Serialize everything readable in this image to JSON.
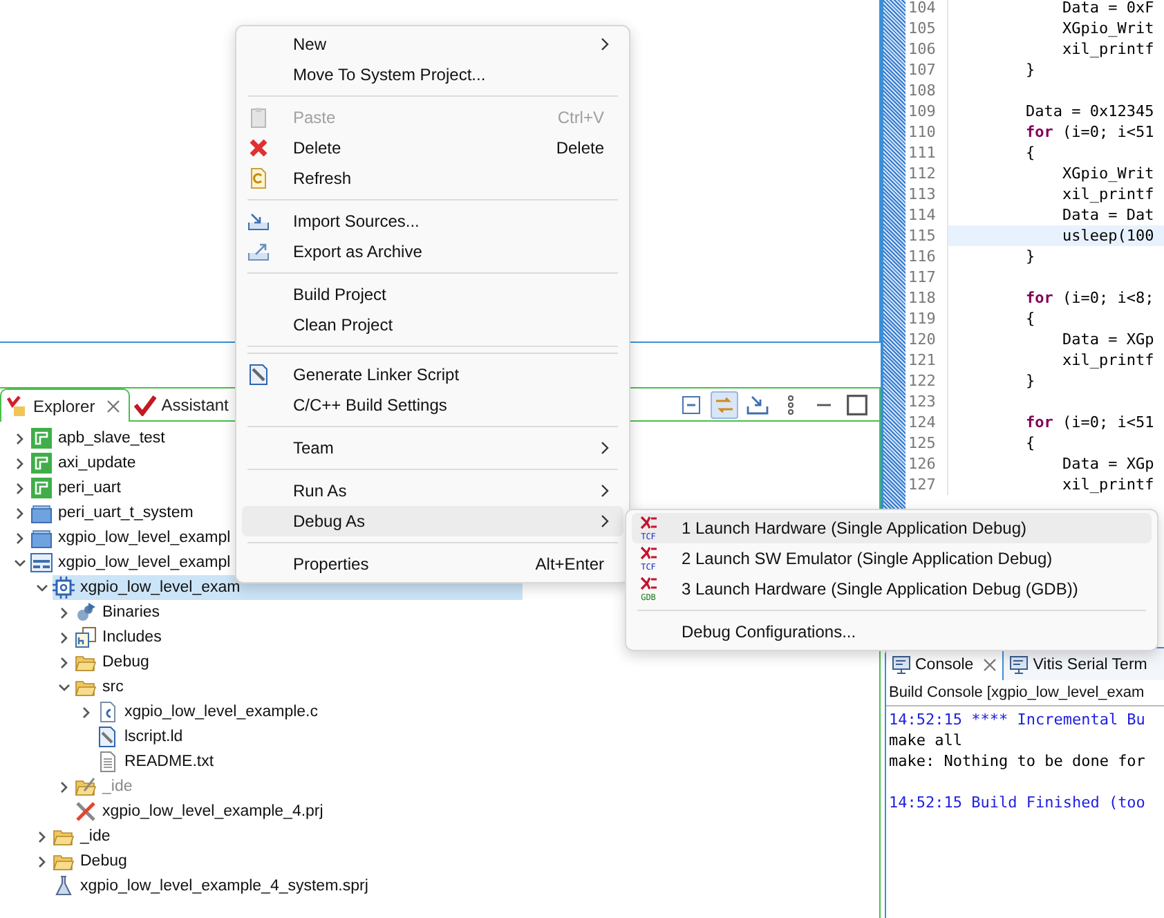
{
  "explorer": {
    "tabs": [
      {
        "label": "Explorer",
        "closable": true,
        "selected": true
      },
      {
        "label": "Assistant",
        "closable": false,
        "selected": false
      }
    ],
    "toolbar": [
      {
        "selected": false
      },
      {
        "selected": true
      },
      {
        "selected": false
      },
      {
        "selected": false
      },
      {
        "selected": false
      },
      {
        "selected": false
      }
    ],
    "tree": [
      {
        "label": "apb_slave_test",
        "kind": "app",
        "expanded": false,
        "selected": false,
        "greyed": false
      },
      {
        "label": "axi_update",
        "kind": "app",
        "expanded": false,
        "selected": false,
        "greyed": false
      },
      {
        "label": "peri_uart",
        "kind": "app",
        "expanded": false,
        "selected": false,
        "greyed": false
      },
      {
        "label": "peri_uart_t_system",
        "kind": "system",
        "expanded": false,
        "selected": false,
        "greyed": false
      },
      {
        "label": "xgpio_low_level_exampl",
        "kind": "system",
        "expanded": false,
        "selected": false,
        "greyed": false
      },
      {
        "label": "xgpio_low_level_exampl",
        "kind": "project",
        "expanded": true,
        "selected": false,
        "greyed": false,
        "children": [
          {
            "label": "xgpio_low_level_exam",
            "kind": "chip",
            "expanded": true,
            "selected": true,
            "greyed": false,
            "children": [
              {
                "label": "Binaries",
                "kind": "binaries",
                "expanded": false,
                "selected": false,
                "greyed": false
              },
              {
                "label": "Includes",
                "kind": "includes",
                "expanded": false,
                "selected": false,
                "greyed": false
              },
              {
                "label": "Debug",
                "kind": "folder",
                "expanded": false,
                "selected": false,
                "greyed": false
              },
              {
                "label": "src",
                "kind": "folder",
                "expanded": true,
                "selected": false,
                "greyed": false,
                "children": [
                  {
                    "label": "xgpio_low_level_example.c",
                    "kind": "cfile",
                    "expanded": false,
                    "selected": false,
                    "greyed": false
                  },
                  {
                    "label": "lscript.ld",
                    "kind": "ldfile",
                    "selected": false,
                    "greyed": false
                  },
                  {
                    "label": "README.txt",
                    "kind": "textfile",
                    "selected": false,
                    "greyed": false
                  }
                ]
              },
              {
                "label": "_ide",
                "kind": "idefolder",
                "expanded": false,
                "selected": false,
                "greyed": true
              },
              {
                "label": "xgpio_low_level_example_4.prj",
                "kind": "prj",
                "selected": false,
                "greyed": false
              }
            ]
          },
          {
            "label": "_ide",
            "kind": "folder",
            "expanded": false,
            "selected": false,
            "greyed": false
          },
          {
            "label": "Debug",
            "kind": "folder",
            "expanded": false,
            "selected": false,
            "greyed": false
          },
          {
            "label": "xgpio_low_level_example_4_system.sprj",
            "kind": "sprj",
            "selected": false,
            "greyed": false
          }
        ]
      }
    ]
  },
  "editor": {
    "lines": [
      {
        "number": "104",
        "text": "            Data = 0xF",
        "current": false
      },
      {
        "number": "105",
        "text": "            XGpio_Writ",
        "current": false
      },
      {
        "number": "106",
        "text": "            xil_printf",
        "current": false
      },
      {
        "number": "107",
        "text": "        }",
        "current": false
      },
      {
        "number": "108",
        "current": false
      },
      {
        "number": "109",
        "text": "        Data = 0x12345",
        "current": false
      },
      {
        "number": "110",
        "text": "        **for** (i=0; i<51",
        "current": false
      },
      {
        "number": "111",
        "text": "        {",
        "current": false
      },
      {
        "number": "112",
        "text": "            XGpio_Writ",
        "current": false
      },
      {
        "number": "113",
        "text": "            xil_printf",
        "current": false
      },
      {
        "number": "114",
        "text": "            Data = Dat",
        "current": false
      },
      {
        "number": "115",
        "text": "            usleep(100",
        "current": true
      },
      {
        "number": "116",
        "text": "        }",
        "current": false
      },
      {
        "number": "117",
        "current": false
      },
      {
        "number": "118",
        "text": "        **for** (i=0; i<8;",
        "current": false
      },
      {
        "number": "119",
        "text": "        {",
        "current": false
      },
      {
        "number": "120",
        "text": "            Data = XGp",
        "current": false
      },
      {
        "number": "121",
        "text": "            xil_printf",
        "current": false
      },
      {
        "number": "122",
        "text": "        }",
        "current": false
      },
      {
        "number": "123",
        "current": false
      },
      {
        "number": "124",
        "text": "        **for** (i=0; i<51",
        "current": false
      },
      {
        "number": "125",
        "text": "        {",
        "current": false
      },
      {
        "number": "126",
        "text": "            Data = XGp",
        "current": false
      },
      {
        "number": "127",
        "text": "            xil_printf",
        "current": false
      }
    ]
  },
  "console": {
    "tabs": [
      {
        "label": "Console",
        "closable": true,
        "selected": true
      },
      {
        "label": "Vitis Serial Term",
        "closable": false,
        "selected": false
      }
    ],
    "header": "Build Console [xgpio_low_level_exam",
    "lines": [
      {
        "kind": "output",
        "text": "14:52:15 **** Incremental Bu",
        "color": "#2020e0"
      },
      {
        "kind": "output",
        "text": "make all",
        "color": "#000000"
      },
      {
        "kind": "output",
        "text": "make: Nothing to be done for",
        "color": "#000000"
      },
      {
        "kind": "blank"
      },
      {
        "kind": "output",
        "text": "14:52:15 Build Finished (too",
        "color": "#2020e0"
      }
    ]
  },
  "context_menu": {
    "items": [
      {
        "kind": "item",
        "label": "New",
        "submenu": true,
        "disabled": false,
        "selected": false
      },
      {
        "kind": "item",
        "label": "Move To System Project...",
        "submenu": false,
        "disabled": false,
        "selected": false
      },
      {
        "kind": "separator"
      },
      {
        "kind": "item",
        "label": "Paste",
        "shortcut": "Ctrl+V",
        "submenu": false,
        "disabled": true,
        "selected": false
      },
      {
        "kind": "item",
        "label": "Delete",
        "shortcut": "Delete",
        "submenu": false,
        "disabled": false,
        "selected": false
      },
      {
        "kind": "item",
        "label": "Refresh",
        "submenu": false,
        "disabled": false,
        "selected": false
      },
      {
        "kind": "separator"
      },
      {
        "kind": "item",
        "label": "Import Sources...",
        "submenu": false,
        "disabled": false,
        "selected": false
      },
      {
        "kind": "item",
        "label": "Export as Archive",
        "submenu": false,
        "disabled": false,
        "selected": false
      },
      {
        "kind": "separator"
      },
      {
        "kind": "item",
        "label": "Build Project",
        "submenu": false,
        "disabled": false,
        "selected": false
      },
      {
        "kind": "item",
        "label": "Clean Project",
        "submenu": false,
        "disabled": false,
        "selected": false
      },
      {
        "kind": "separator"
      },
      {
        "kind": "separator"
      },
      {
        "kind": "item",
        "label": "Generate Linker Script",
        "submenu": false,
        "disabled": false,
        "selected": false
      },
      {
        "kind": "item",
        "label": "C/C++ Build Settings",
        "submenu": false,
        "disabled": false,
        "selected": false
      },
      {
        "kind": "separator"
      },
      {
        "kind": "item",
        "label": "Team",
        "submenu": true,
        "disabled": false,
        "selected": false
      },
      {
        "kind": "separator"
      },
      {
        "kind": "item",
        "label": "Run As",
        "submenu": true,
        "disabled": false,
        "selected": false
      },
      {
        "kind": "item",
        "label": "Debug As",
        "submenu": true,
        "disabled": false,
        "selected": true
      },
      {
        "kind": "separator"
      },
      {
        "kind": "item",
        "label": "Properties",
        "shortcut": "Alt+Enter",
        "submenu": false,
        "disabled": false,
        "selected": false
      }
    ]
  },
  "submenu": {
    "items": [
      {
        "kind": "item",
        "label": "1 Launch Hardware (Single Application Debug)",
        "badge": "TCF",
        "selected": true
      },
      {
        "kind": "item",
        "label": "2 Launch SW Emulator (Single Application Debug)",
        "badge": "TCF",
        "selected": false
      },
      {
        "kind": "item",
        "label": "3 Launch Hardware (Single Application Debug (GDB))",
        "badge": "GDB",
        "selected": false
      },
      {
        "kind": "separator"
      },
      {
        "kind": "item",
        "label": "Debug Configurations...",
        "selected": false
      }
    ]
  }
}
